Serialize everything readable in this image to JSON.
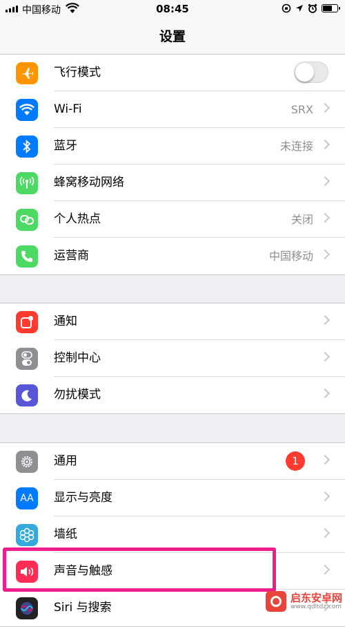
{
  "status_bar": {
    "carrier": "中国移动",
    "time": "08:45"
  },
  "nav": {
    "title": "设置"
  },
  "groups": [
    {
      "rows": [
        {
          "label": "飞行模式",
          "icon": "airplane-icon",
          "color": "#ff9500",
          "toggle_on": false
        },
        {
          "label": "Wi-Fi",
          "value": "SRX",
          "icon": "wifi-icon",
          "color": "#007aff"
        },
        {
          "label": "蓝牙",
          "value": "未连接",
          "icon": "bluetooth-icon",
          "color": "#007aff"
        },
        {
          "label": "蜂窝移动网络",
          "icon": "cellular-icon",
          "color": "#4cd964"
        },
        {
          "label": "个人热点",
          "value": "关闭",
          "icon": "hotspot-icon",
          "color": "#4cd964"
        },
        {
          "label": "运营商",
          "value": "中国移动",
          "icon": "phone-icon",
          "color": "#4cd964"
        }
      ]
    },
    {
      "rows": [
        {
          "label": "通知",
          "icon": "notifications-icon",
          "color": "#ff3b30"
        },
        {
          "label": "控制中心",
          "icon": "control-center-icon",
          "color": "#8e8e93"
        },
        {
          "label": "勿扰模式",
          "icon": "moon-icon",
          "color": "#5856d6"
        }
      ]
    },
    {
      "rows": [
        {
          "label": "通用",
          "badge": "1",
          "icon": "gear-icon",
          "color": "#8e8e93"
        },
        {
          "label": "显示与亮度",
          "icon": "display-icon",
          "color": "#007aff"
        },
        {
          "label": "墙纸",
          "icon": "wallpaper-icon",
          "color": "#34aadc"
        },
        {
          "label": "声音与触感",
          "icon": "speaker-icon",
          "color": "#ff2d55"
        },
        {
          "label": "Siri 与搜索",
          "icon": "siri-icon",
          "color": "#222222"
        }
      ]
    }
  ],
  "display_icon_text": "AA",
  "watermark": {
    "name": "启东安卓网",
    "url": "www.qdltdz.com"
  }
}
